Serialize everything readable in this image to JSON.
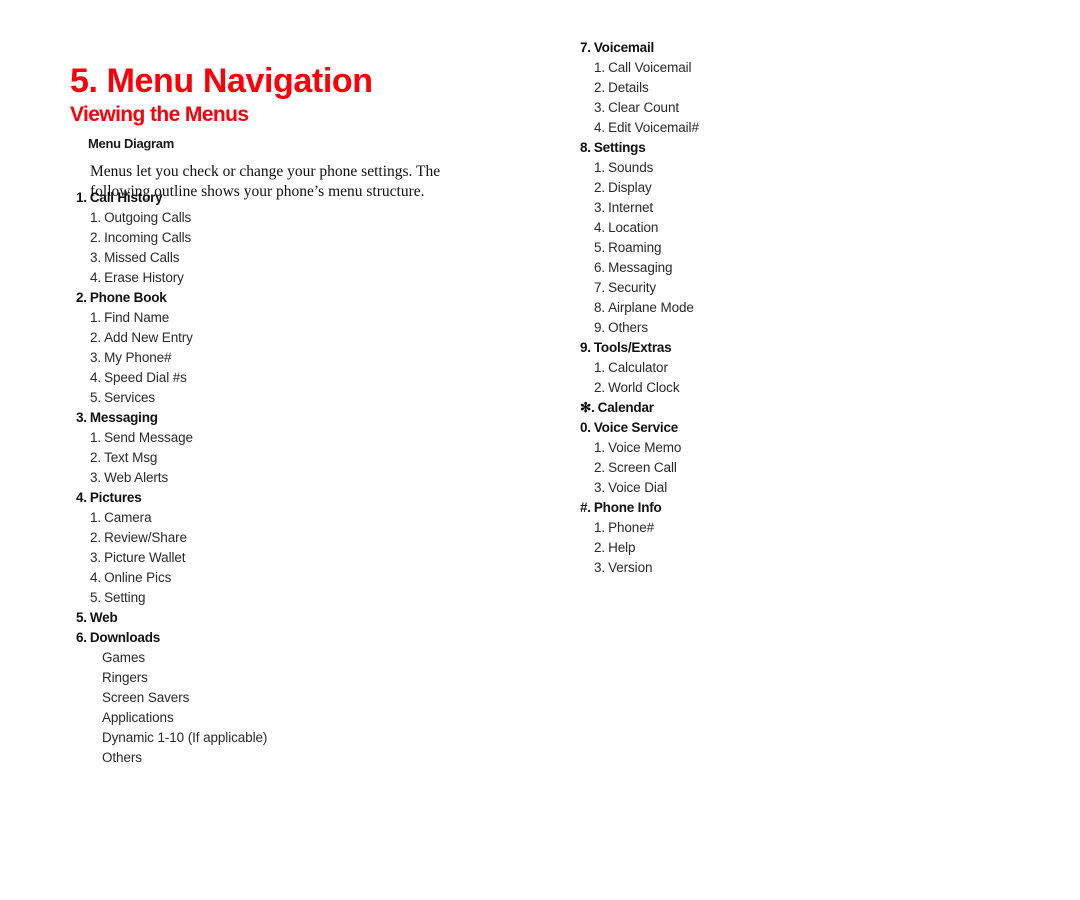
{
  "document": {
    "chapter_title": "5. Menu Navigation",
    "section_title": "Viewing the Menus",
    "sub_heading": "Menu Diagram",
    "intro_paragraph": "Menus let you check or change your phone settings. The following outline shows your phone’s menu structure.",
    "accent_color": "#fb0007",
    "text_color": "#111111",
    "background_color": "#ffffff"
  },
  "outline": {
    "left_column": [
      {
        "level": 1,
        "marker": "1.",
        "label": "Call History"
      },
      {
        "level": 2,
        "marker": "1.",
        "label": "Outgoing Calls"
      },
      {
        "level": 2,
        "marker": "2.",
        "label": "Incoming Calls"
      },
      {
        "level": 2,
        "marker": "3.",
        "label": "Missed Calls"
      },
      {
        "level": 2,
        "marker": "4.",
        "label": "Erase History"
      },
      {
        "level": 1,
        "marker": "2.",
        "label": "Phone Book"
      },
      {
        "level": 2,
        "marker": "1.",
        "label": "Find Name"
      },
      {
        "level": 2,
        "marker": "2.",
        "label": "Add New Entry"
      },
      {
        "level": 2,
        "marker": "3.",
        "label": "My Phone#"
      },
      {
        "level": 2,
        "marker": "4.",
        "label": "Speed Dial #s"
      },
      {
        "level": 2,
        "marker": "5.",
        "label": "Services"
      },
      {
        "level": 1,
        "marker": "3.",
        "label": "Messaging"
      },
      {
        "level": 2,
        "marker": "1.",
        "label": "Send Message"
      },
      {
        "level": 2,
        "marker": "2.",
        "label": "Text Msg"
      },
      {
        "level": 2,
        "marker": "3.",
        "label": "Web Alerts"
      },
      {
        "level": 1,
        "marker": "4.",
        "label": "Pictures"
      },
      {
        "level": 2,
        "marker": "1.",
        "label": "Camera"
      },
      {
        "level": 2,
        "marker": "2.",
        "label": "Review/Share"
      },
      {
        "level": 2,
        "marker": "3.",
        "label": "Picture Wallet"
      },
      {
        "level": 2,
        "marker": "4.",
        "label": "Online Pics"
      },
      {
        "level": 2,
        "marker": "5.",
        "label": "Setting"
      },
      {
        "level": 1,
        "marker": "5.",
        "label": "Web"
      },
      {
        "level": 1,
        "marker": "6.",
        "label": "Downloads"
      },
      {
        "level": 2,
        "marker": "",
        "label": "Games"
      },
      {
        "level": 2,
        "marker": "",
        "label": "Ringers"
      },
      {
        "level": 2,
        "marker": "",
        "label": "Screen Savers"
      },
      {
        "level": 2,
        "marker": "",
        "label": "Applications"
      },
      {
        "level": 2,
        "marker": "",
        "label": "Dynamic 1-10 (If applicable)"
      },
      {
        "level": 2,
        "marker": "",
        "label": "Others"
      }
    ],
    "right_column": [
      {
        "level": 1,
        "marker": "7.",
        "label": "Voicemail"
      },
      {
        "level": 2,
        "marker": "1.",
        "label": "Call Voicemail"
      },
      {
        "level": 2,
        "marker": "2.",
        "label": "Details"
      },
      {
        "level": 2,
        "marker": "3.",
        "label": "Clear Count"
      },
      {
        "level": 2,
        "marker": "4.",
        "label": "Edit Voicemail#"
      },
      {
        "level": 1,
        "marker": "8.",
        "label": "Settings"
      },
      {
        "level": 2,
        "marker": "1.",
        "label": "Sounds"
      },
      {
        "level": 2,
        "marker": "2.",
        "label": "Display"
      },
      {
        "level": 2,
        "marker": "3.",
        "label": "Internet"
      },
      {
        "level": 2,
        "marker": "4.",
        "label": "Location"
      },
      {
        "level": 2,
        "marker": "5.",
        "label": "Roaming"
      },
      {
        "level": 2,
        "marker": "6.",
        "label": "Messaging"
      },
      {
        "level": 2,
        "marker": "7.",
        "label": "Security"
      },
      {
        "level": 2,
        "marker": "8.",
        "label": "Airplane Mode"
      },
      {
        "level": 2,
        "marker": "9.",
        "label": "Others"
      },
      {
        "level": 1,
        "marker": "9.",
        "label": "Tools/Extras"
      },
      {
        "level": 2,
        "marker": "1.",
        "label": "Calculator"
      },
      {
        "level": 2,
        "marker": "2.",
        "label": "World Clock"
      },
      {
        "level": 1,
        "marker": "✻.",
        "label": "Calendar"
      },
      {
        "level": 1,
        "marker": "0.",
        "label": "Voice Service"
      },
      {
        "level": 2,
        "marker": "1.",
        "label": "Voice Memo"
      },
      {
        "level": 2,
        "marker": "2.",
        "label": "Screen Call"
      },
      {
        "level": 2,
        "marker": "3.",
        "label": "Voice Dial"
      },
      {
        "level": 1,
        "marker": "#.",
        "label": "Phone Info"
      },
      {
        "level": 2,
        "marker": "1.",
        "label": "Phone#"
      },
      {
        "level": 2,
        "marker": "2.",
        "label": "Help"
      },
      {
        "level": 2,
        "marker": "3.",
        "label": "Version"
      }
    ]
  }
}
